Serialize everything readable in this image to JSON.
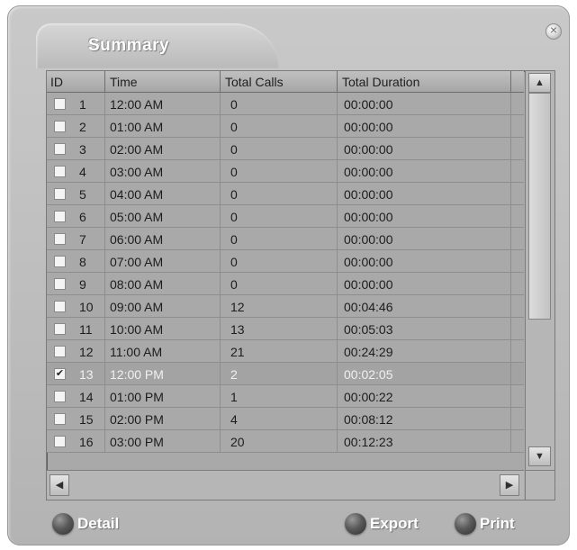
{
  "window": {
    "title": "Summary"
  },
  "table": {
    "columns": [
      "ID",
      "Time",
      "Total Calls",
      "Total Duration"
    ],
    "rows": [
      {
        "id": "1",
        "time": "12:00 AM",
        "calls": "0",
        "duration": "00:00:00",
        "checked": false
      },
      {
        "id": "2",
        "time": "01:00 AM",
        "calls": "0",
        "duration": "00:00:00",
        "checked": false
      },
      {
        "id": "3",
        "time": "02:00 AM",
        "calls": "0",
        "duration": "00:00:00",
        "checked": false
      },
      {
        "id": "4",
        "time": "03:00 AM",
        "calls": "0",
        "duration": "00:00:00",
        "checked": false
      },
      {
        "id": "5",
        "time": "04:00 AM",
        "calls": "0",
        "duration": "00:00:00",
        "checked": false
      },
      {
        "id": "6",
        "time": "05:00 AM",
        "calls": "0",
        "duration": "00:00:00",
        "checked": false
      },
      {
        "id": "7",
        "time": "06:00 AM",
        "calls": "0",
        "duration": "00:00:00",
        "checked": false
      },
      {
        "id": "8",
        "time": "07:00 AM",
        "calls": "0",
        "duration": "00:00:00",
        "checked": false
      },
      {
        "id": "9",
        "time": "08:00 AM",
        "calls": "0",
        "duration": "00:00:00",
        "checked": false
      },
      {
        "id": "10",
        "time": "09:00 AM",
        "calls": "12",
        "duration": "00:04:46",
        "checked": false
      },
      {
        "id": "11",
        "time": "10:00 AM",
        "calls": "13",
        "duration": "00:05:03",
        "checked": false
      },
      {
        "id": "12",
        "time": "11:00 AM",
        "calls": "21",
        "duration": "00:24:29",
        "checked": false
      },
      {
        "id": "13",
        "time": "12:00 PM",
        "calls": "2",
        "duration": "00:02:05",
        "checked": true
      },
      {
        "id": "14",
        "time": "01:00 PM",
        "calls": "1",
        "duration": "00:00:22",
        "checked": false
      },
      {
        "id": "15",
        "time": "02:00 PM",
        "calls": "4",
        "duration": "00:08:12",
        "checked": false
      },
      {
        "id": "16",
        "time": "03:00 PM",
        "calls": "20",
        "duration": "00:12:23",
        "checked": false
      }
    ]
  },
  "actions": {
    "detail": "Detail",
    "export": "Export",
    "print": "Print"
  },
  "icons": {
    "close": "close-icon",
    "scroll_up": "arrow-up-icon",
    "scroll_down": "arrow-down-icon",
    "scroll_left": "arrow-left-icon",
    "scroll_right": "arrow-right-icon",
    "checkmark": "checkmark-icon"
  },
  "colors": {
    "window_bg": "#c4c4c4",
    "grid_bg": "#a9a9a9",
    "selected_text": "#f0f0f0"
  }
}
